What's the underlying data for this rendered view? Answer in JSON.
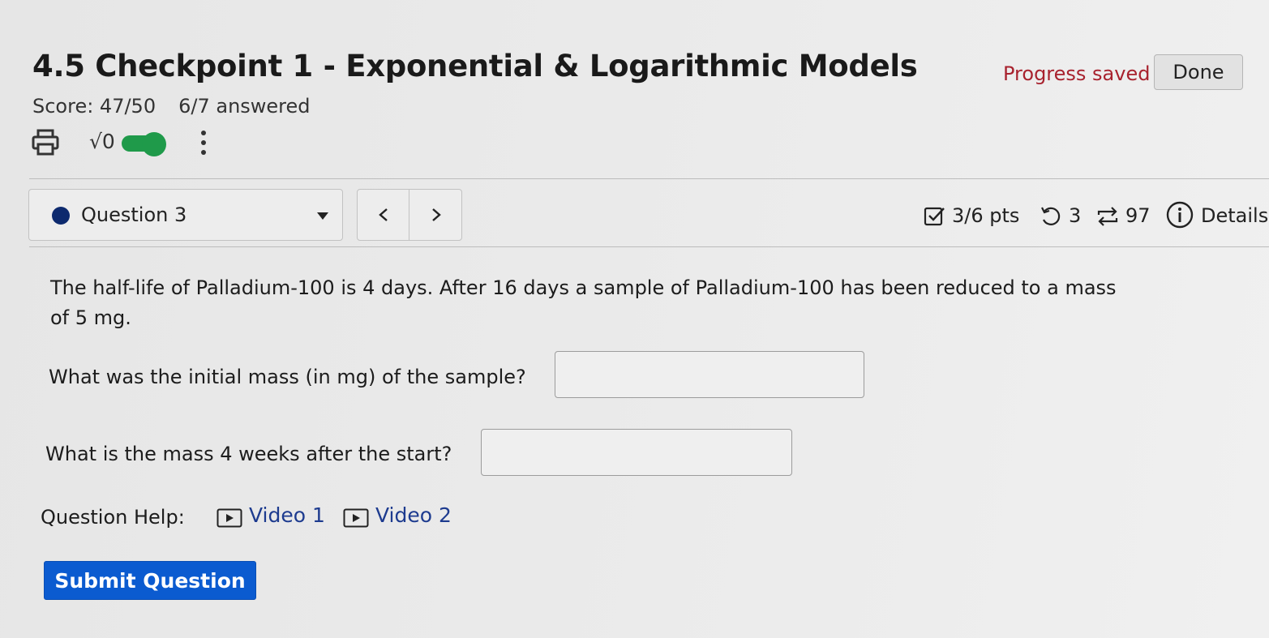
{
  "header": {
    "title": "4.5 Checkpoint 1 - Exponential & Logarithmic Models",
    "progress_status": "Progress saved",
    "done_label": "Done",
    "score": "Score: 47/50",
    "answered": "6/7 answered"
  },
  "toolbar": {
    "math_symbol": "√0",
    "math_toggle_on": true,
    "icons": [
      "printer-icon",
      "sqrt-icon",
      "toggle-switch",
      "kebab-menu-icon"
    ]
  },
  "question_bar": {
    "selected_question": "Question 3",
    "points": "3/6 pts",
    "retries": "3",
    "attempts": "97",
    "details_label": "Details",
    "icons": [
      "checkbox-icon",
      "undo-icon",
      "repeat-icon",
      "info-icon",
      "chevron-left-icon",
      "chevron-right-icon",
      "caret-down-icon"
    ]
  },
  "question": {
    "text": "The half-life of Palladium-100 is 4 days. After 16 days a sample of Palladium-100 has been reduced to a mass of 5 mg.",
    "prompt_1": "What was the initial mass (in mg) of the sample?",
    "answer_1": "",
    "prompt_2": "What is the mass 4 weeks after the start?",
    "answer_2": ""
  },
  "help": {
    "label": "Question Help:",
    "video_1": "Video 1",
    "video_2": "Video 2"
  },
  "submit_label": "Submit Question",
  "colors": {
    "accent_blue": "#0b5bd0",
    "progress_red": "#a8222e",
    "toggle_green": "#1f9a4a",
    "question_dot": "#0d2a6e",
    "link_blue": "#1d3b8f"
  }
}
